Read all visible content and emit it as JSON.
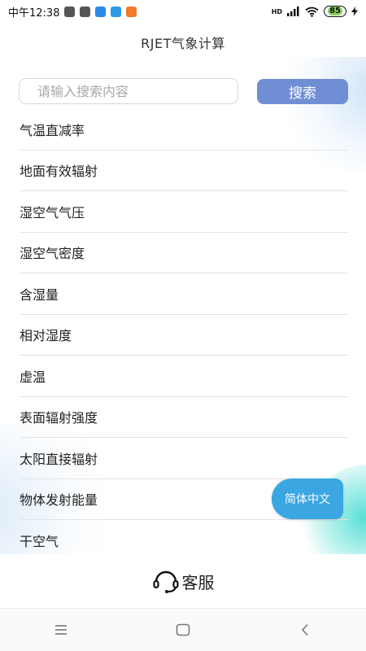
{
  "status_bar": {
    "time": "中午12:38",
    "app_icons": [
      {
        "name": "mail-icon",
        "color": "#555555"
      },
      {
        "name": "mail-icon",
        "color": "#555555"
      },
      {
        "name": "n-app-icon",
        "color": "#2b8be6"
      },
      {
        "name": "message-app-icon",
        "color": "#2b9be6"
      },
      {
        "name": "mi-app-icon",
        "color": "#f27a2a"
      }
    ],
    "network": "HD",
    "battery": "85"
  },
  "header": {
    "title": "RJET气象计算"
  },
  "search": {
    "placeholder": "请输入搜索内容",
    "button_label": "搜索"
  },
  "list": {
    "items": [
      "气温直减率",
      "地面有效辐射",
      "湿空气气压",
      "湿空气密度",
      "含湿量",
      "相对湿度",
      "虚温",
      "表面辐射强度",
      "太阳直接辐射",
      "物体发射能量",
      "干空气"
    ]
  },
  "language_button": {
    "label": "简体中文"
  },
  "service": {
    "label": "客服"
  },
  "colors": {
    "accent": "#6f8ed4",
    "language_button": "#3aa6e2"
  }
}
